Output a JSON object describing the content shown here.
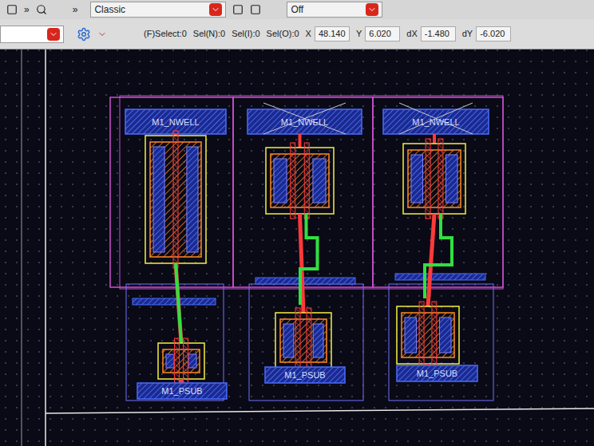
{
  "toolbar": {
    "view_mode": "Classic",
    "snap": "Off",
    "more_left": "»",
    "more_right": "»"
  },
  "status": {
    "selection": [
      "(F)Select:0",
      "Sel(N):0",
      "Sel(I):0",
      "Sel(O):0"
    ],
    "coords": [
      {
        "label": "X",
        "value": "48.140"
      },
      {
        "label": "Y",
        "value": "6.020"
      },
      {
        "label": "dX",
        "value": "-1.480"
      },
      {
        "label": "dY",
        "value": "-6.020"
      }
    ]
  },
  "cells": [
    {
      "kind": "wide",
      "top_label": "M1_NWELL",
      "bottom_label": "M1_PSUB"
    },
    {
      "kind": "split",
      "top_label": "M1_NWELL",
      "bottom_label": "M1_PSUB"
    },
    {
      "kind": "split",
      "top_label": "M1_NWELL",
      "bottom_label": "M1_PSUB"
    }
  ]
}
